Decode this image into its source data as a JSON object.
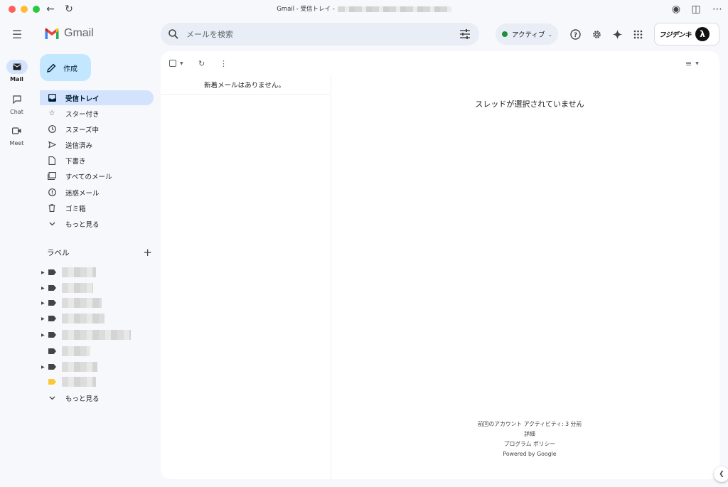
{
  "window": {
    "title": "Gmail - 受信トレイ -"
  },
  "rail": {
    "items": [
      {
        "label": "Mail",
        "icon": "mail-icon"
      },
      {
        "label": "Chat",
        "icon": "chat-icon"
      },
      {
        "label": "Meet",
        "icon": "video-icon"
      }
    ]
  },
  "header": {
    "app_name": "Gmail",
    "search": {
      "placeholder": "メールを検索"
    },
    "status": {
      "label": "アクティブ",
      "color": "#1e8e3e"
    },
    "account_brand": "フジデンキ"
  },
  "nav": {
    "compose_label": "作成",
    "items": [
      {
        "label": "受信トレイ",
        "icon": "inbox-icon",
        "active": true
      },
      {
        "label": "スター付き",
        "icon": "star-icon"
      },
      {
        "label": "スヌーズ中",
        "icon": "clock-icon"
      },
      {
        "label": "送信済み",
        "icon": "send-icon"
      },
      {
        "label": "下書き",
        "icon": "draft-icon"
      },
      {
        "label": "すべてのメール",
        "icon": "all-mail-icon"
      },
      {
        "label": "迷惑メール",
        "icon": "spam-icon"
      },
      {
        "label": "ゴミ箱",
        "icon": "trash-icon"
      },
      {
        "label": "もっと見る",
        "icon": "chevron-down-icon"
      }
    ],
    "labels_header": "ラベル",
    "labels_more": "もっと見る"
  },
  "main": {
    "empty_list": "新着メールはありません。",
    "empty_thread": "スレッドが選択されていません",
    "footer": {
      "activity": "前回のアカウント アクティビティ: 3 分前",
      "details": "詳細",
      "policy": "プログラム ポリシー",
      "powered": "Powered by Google"
    }
  },
  "colors": {
    "accent": "#c2e7ff",
    "active_nav": "#d3e3fd",
    "background": "#f6f8fc"
  }
}
